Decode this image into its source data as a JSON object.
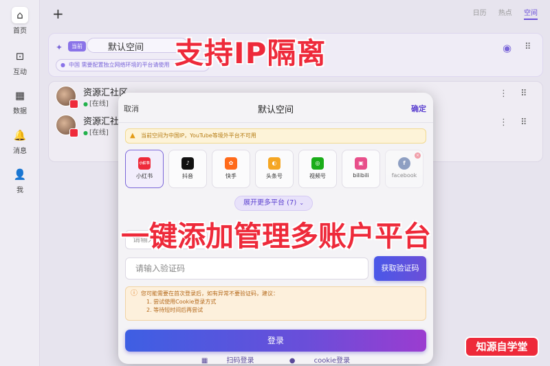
{
  "nav": [
    {
      "icon": "⌂",
      "label": "首页"
    },
    {
      "icon": "⊡",
      "label": "互动"
    },
    {
      "icon": "▦",
      "label": "数据"
    },
    {
      "icon": "🔔",
      "label": "消息"
    },
    {
      "icon": "👤",
      "label": "我"
    }
  ],
  "topbar": {
    "add": "+",
    "tabs": [
      "日历",
      "热点",
      "空间"
    ]
  },
  "workspace": {
    "badge": "当前",
    "name": "默认空间",
    "notice": "中国 需要配置独立网络环境的平台请使用"
  },
  "headline_top": "支持IP隔离",
  "accounts": [
    {
      "name": "资源汇社区",
      "status": "在线"
    },
    {
      "name": "资源汇社区",
      "status": "在线"
    }
  ],
  "modal": {
    "cancel": "取消",
    "title": "默认空间",
    "confirm": "确定",
    "warning": "当前空间为中国IP，YouTube等境外平台不可用",
    "platforms": [
      {
        "label": "小红书",
        "color": "#ee2a3a",
        "glyph": "小红书"
      },
      {
        "label": "抖音",
        "color": "#111111",
        "glyph": "♪"
      },
      {
        "label": "快手",
        "color": "#ff6a1a",
        "glyph": "✿"
      },
      {
        "label": "头条号",
        "color": "#f5a623",
        "glyph": "◐"
      },
      {
        "label": "视频号",
        "color": "#1aad19",
        "glyph": "◎"
      },
      {
        "label": "bilibili",
        "color": "#e84f8a",
        "glyph": "▣"
      },
      {
        "label": "facebook",
        "color": "#3b5998",
        "glyph": "f"
      }
    ],
    "expand": "展开更多平台 (7)",
    "phone_placeholder": "请输入手机号",
    "code_placeholder": "请输入验证码",
    "get_code": "获取验证码",
    "tips_title": "您可能需要在首次登录后，如有异常不要验证码，建议：",
    "tips_1": "1. 尝试使用Cookie登录方式",
    "tips_2": "2. 等待短时间后再尝试",
    "login": "登录",
    "qr_login": "扫码登录",
    "cookie_login": "cookie登录"
  },
  "headline_mid": "一键添加管理多账户平台",
  "brand": "知源自学堂"
}
